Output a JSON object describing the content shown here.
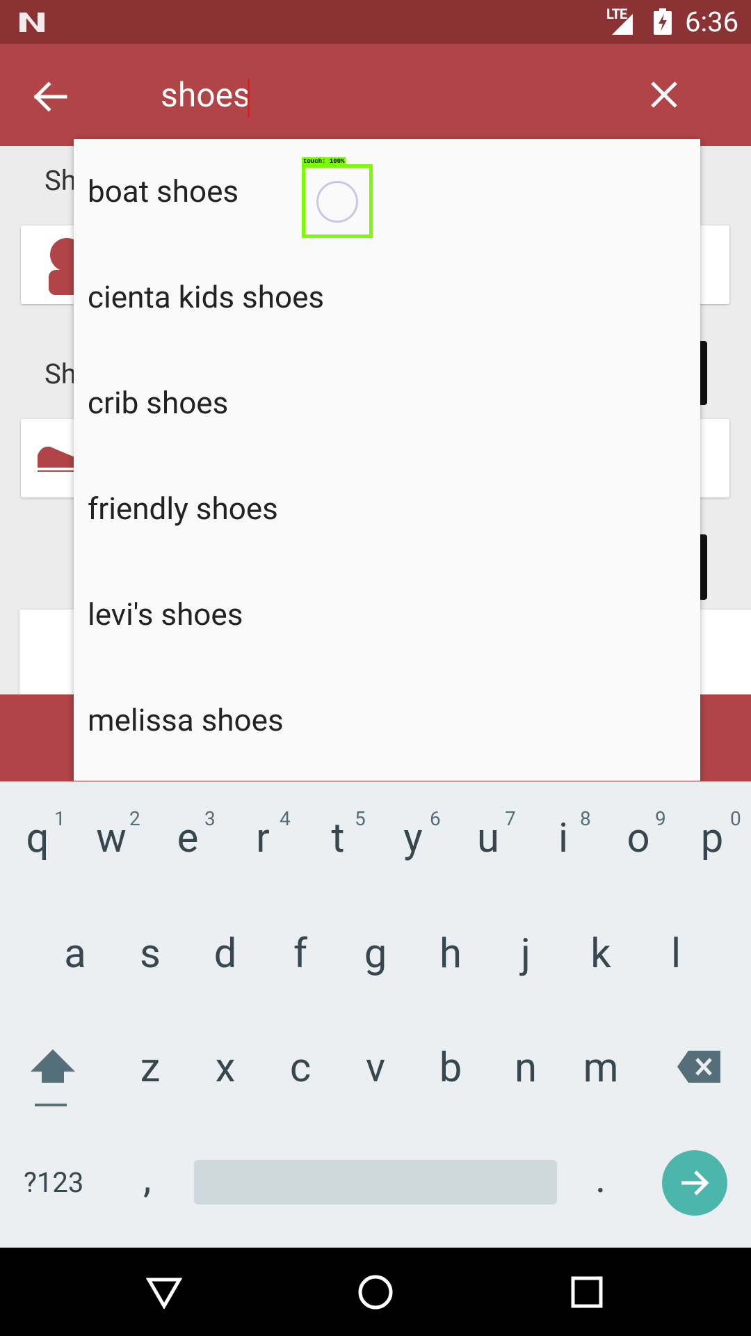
{
  "status_bar": {
    "network": "LTE",
    "time": "6:36"
  },
  "search": {
    "query": "shoes"
  },
  "suggestions": [
    "boat shoes",
    "cienta kids shoes",
    "crib shoes",
    "friendly shoes",
    "levi's shoes",
    "melissa shoes"
  ],
  "background": {
    "heading1": "Sh",
    "heading2": "Sh"
  },
  "touch_overlay": {
    "label": "touch: 100%"
  },
  "keyboard": {
    "row1": [
      {
        "key": "q",
        "hint": "1"
      },
      {
        "key": "w",
        "hint": "2"
      },
      {
        "key": "e",
        "hint": "3"
      },
      {
        "key": "r",
        "hint": "4"
      },
      {
        "key": "t",
        "hint": "5"
      },
      {
        "key": "y",
        "hint": "6"
      },
      {
        "key": "u",
        "hint": "7"
      },
      {
        "key": "i",
        "hint": "8"
      },
      {
        "key": "o",
        "hint": "9"
      },
      {
        "key": "p",
        "hint": "0"
      }
    ],
    "row2": [
      "a",
      "s",
      "d",
      "f",
      "g",
      "h",
      "j",
      "k",
      "l"
    ],
    "row3": [
      "z",
      "x",
      "c",
      "v",
      "b",
      "n",
      "m"
    ],
    "symbols_label": "?123",
    "comma": ",",
    "period": "."
  },
  "colors": {
    "status_bar": "#8b3234",
    "toolbar": "#b04446",
    "enter_key": "#4db6ac"
  }
}
